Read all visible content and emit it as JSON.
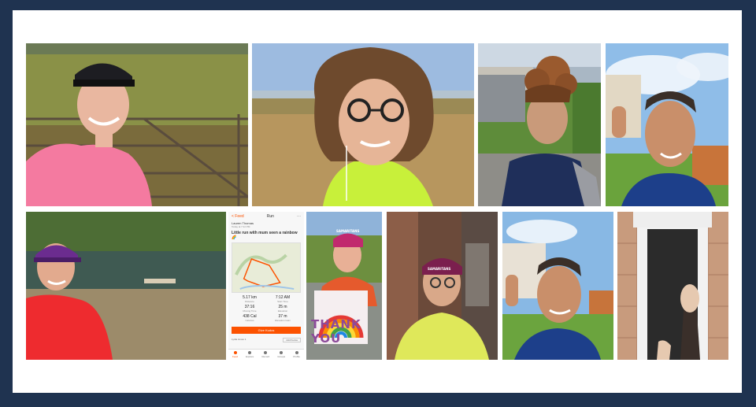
{
  "collage": {
    "photo_count": 11,
    "photos": [
      {
        "id": "p1",
        "subject": "woman-pink-shirt-field-gate"
      },
      {
        "id": "p2",
        "subject": "woman-glasses-hi-vis-moorland"
      },
      {
        "id": "p3",
        "subject": "woman-curly-hair-street"
      },
      {
        "id": "p4",
        "subject": "man-thumbs-up-garden"
      },
      {
        "id": "p5",
        "subject": "woman-red-shirt-riverside"
      },
      {
        "id": "p6",
        "subject": "strava-run-screenshot"
      },
      {
        "id": "p7",
        "subject": "woman-thank-you-rainbow-sign"
      },
      {
        "id": "p8",
        "subject": "woman-yellow-jacket-doorway"
      },
      {
        "id": "p9",
        "subject": "man-thumbs-up-street"
      },
      {
        "id": "p10",
        "subject": "treadmill-feet"
      }
    ]
  },
  "strava": {
    "back_label": "< Feed",
    "header_title": "Run",
    "athlete_name": "Lauren Thomas",
    "athlete_sub": "Today at 7:12 PM",
    "activity_title": "Little run with mum seen a rainbow 🌈",
    "stats": [
      {
        "label": "Distance",
        "value": "5.17 km"
      },
      {
        "label": "Start Time",
        "value": "7:12 AM"
      },
      {
        "label": "Moving Time",
        "value": "37:16"
      },
      {
        "label": "Elevation",
        "value": "25 m"
      },
      {
        "label": "Calories",
        "value": "438 Cal"
      },
      {
        "label": "Elevation Gain",
        "value": "37 m"
      }
    ],
    "kudos_button": "Give Kudos",
    "kudos_text": "Lydia Jones 1",
    "add_button": "Add Kudos",
    "tabs": [
      "Feed",
      "Explore",
      "Record",
      "Groups",
      "Profile"
    ]
  },
  "signs": {
    "thank_you": "THANK YOU",
    "cap_label": "SAMARITANS"
  },
  "colors": {
    "frame_border": "#1f3350",
    "frame_bg": "#ffffff",
    "strava_orange": "#fc5200"
  }
}
